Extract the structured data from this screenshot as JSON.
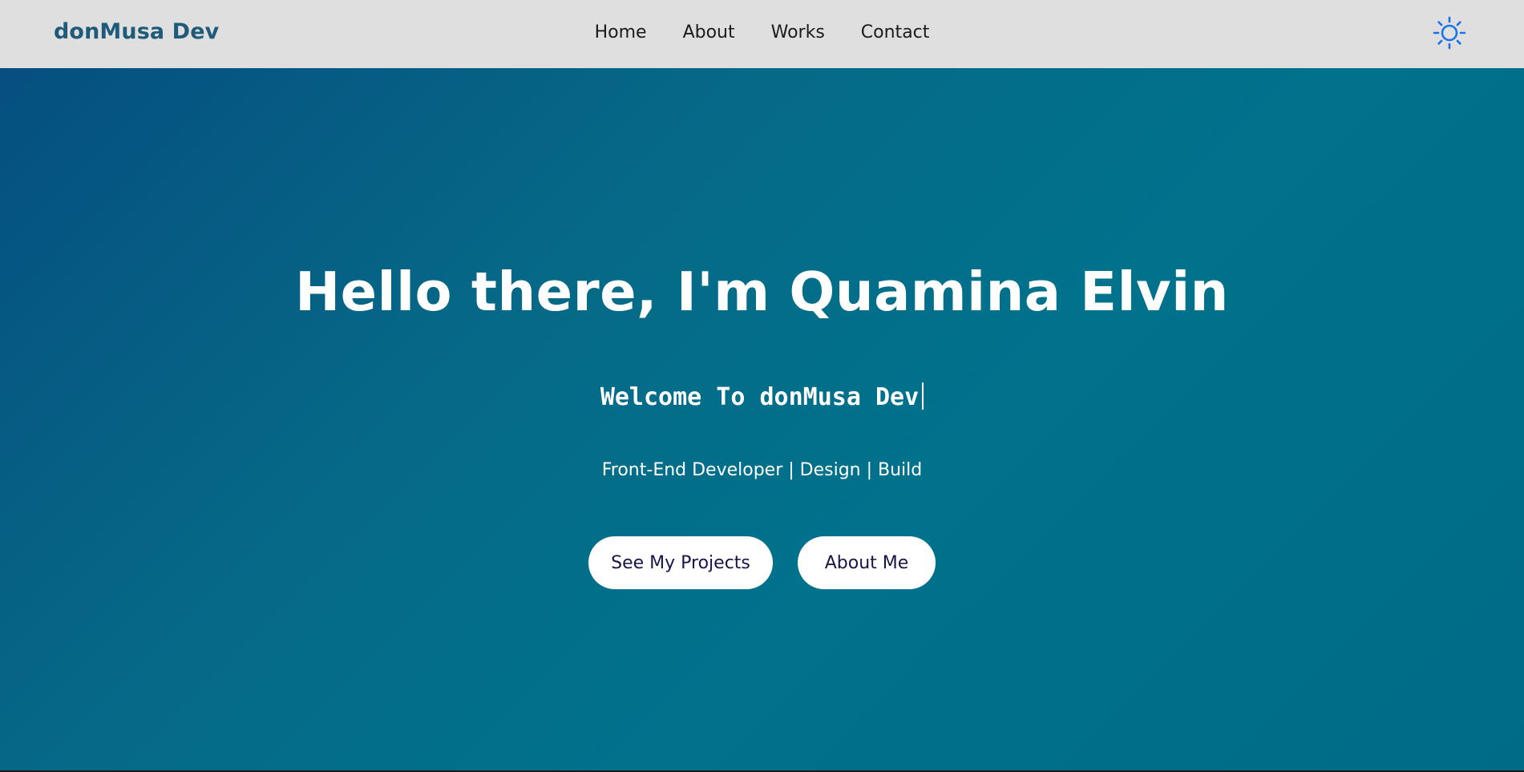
{
  "navbar": {
    "brand": "donMusa Dev",
    "links": [
      "Home",
      "About",
      "Works",
      "Contact"
    ],
    "theme_icon": "sun-icon",
    "theme_icon_color": "#1a73e8",
    "background": "#dfdfdf"
  },
  "hero": {
    "title": "Hello there, I'm Quamina Elvin",
    "typing_text": "Welcome To donMusa Dev",
    "tagline": "Front-End Developer | Design | Build",
    "buttons": {
      "projects": "See My Projects",
      "about": "About Me"
    },
    "colors": {
      "gradient_start": "#054f80",
      "gradient_end": "#006b85",
      "button_text": "#16154a"
    }
  }
}
